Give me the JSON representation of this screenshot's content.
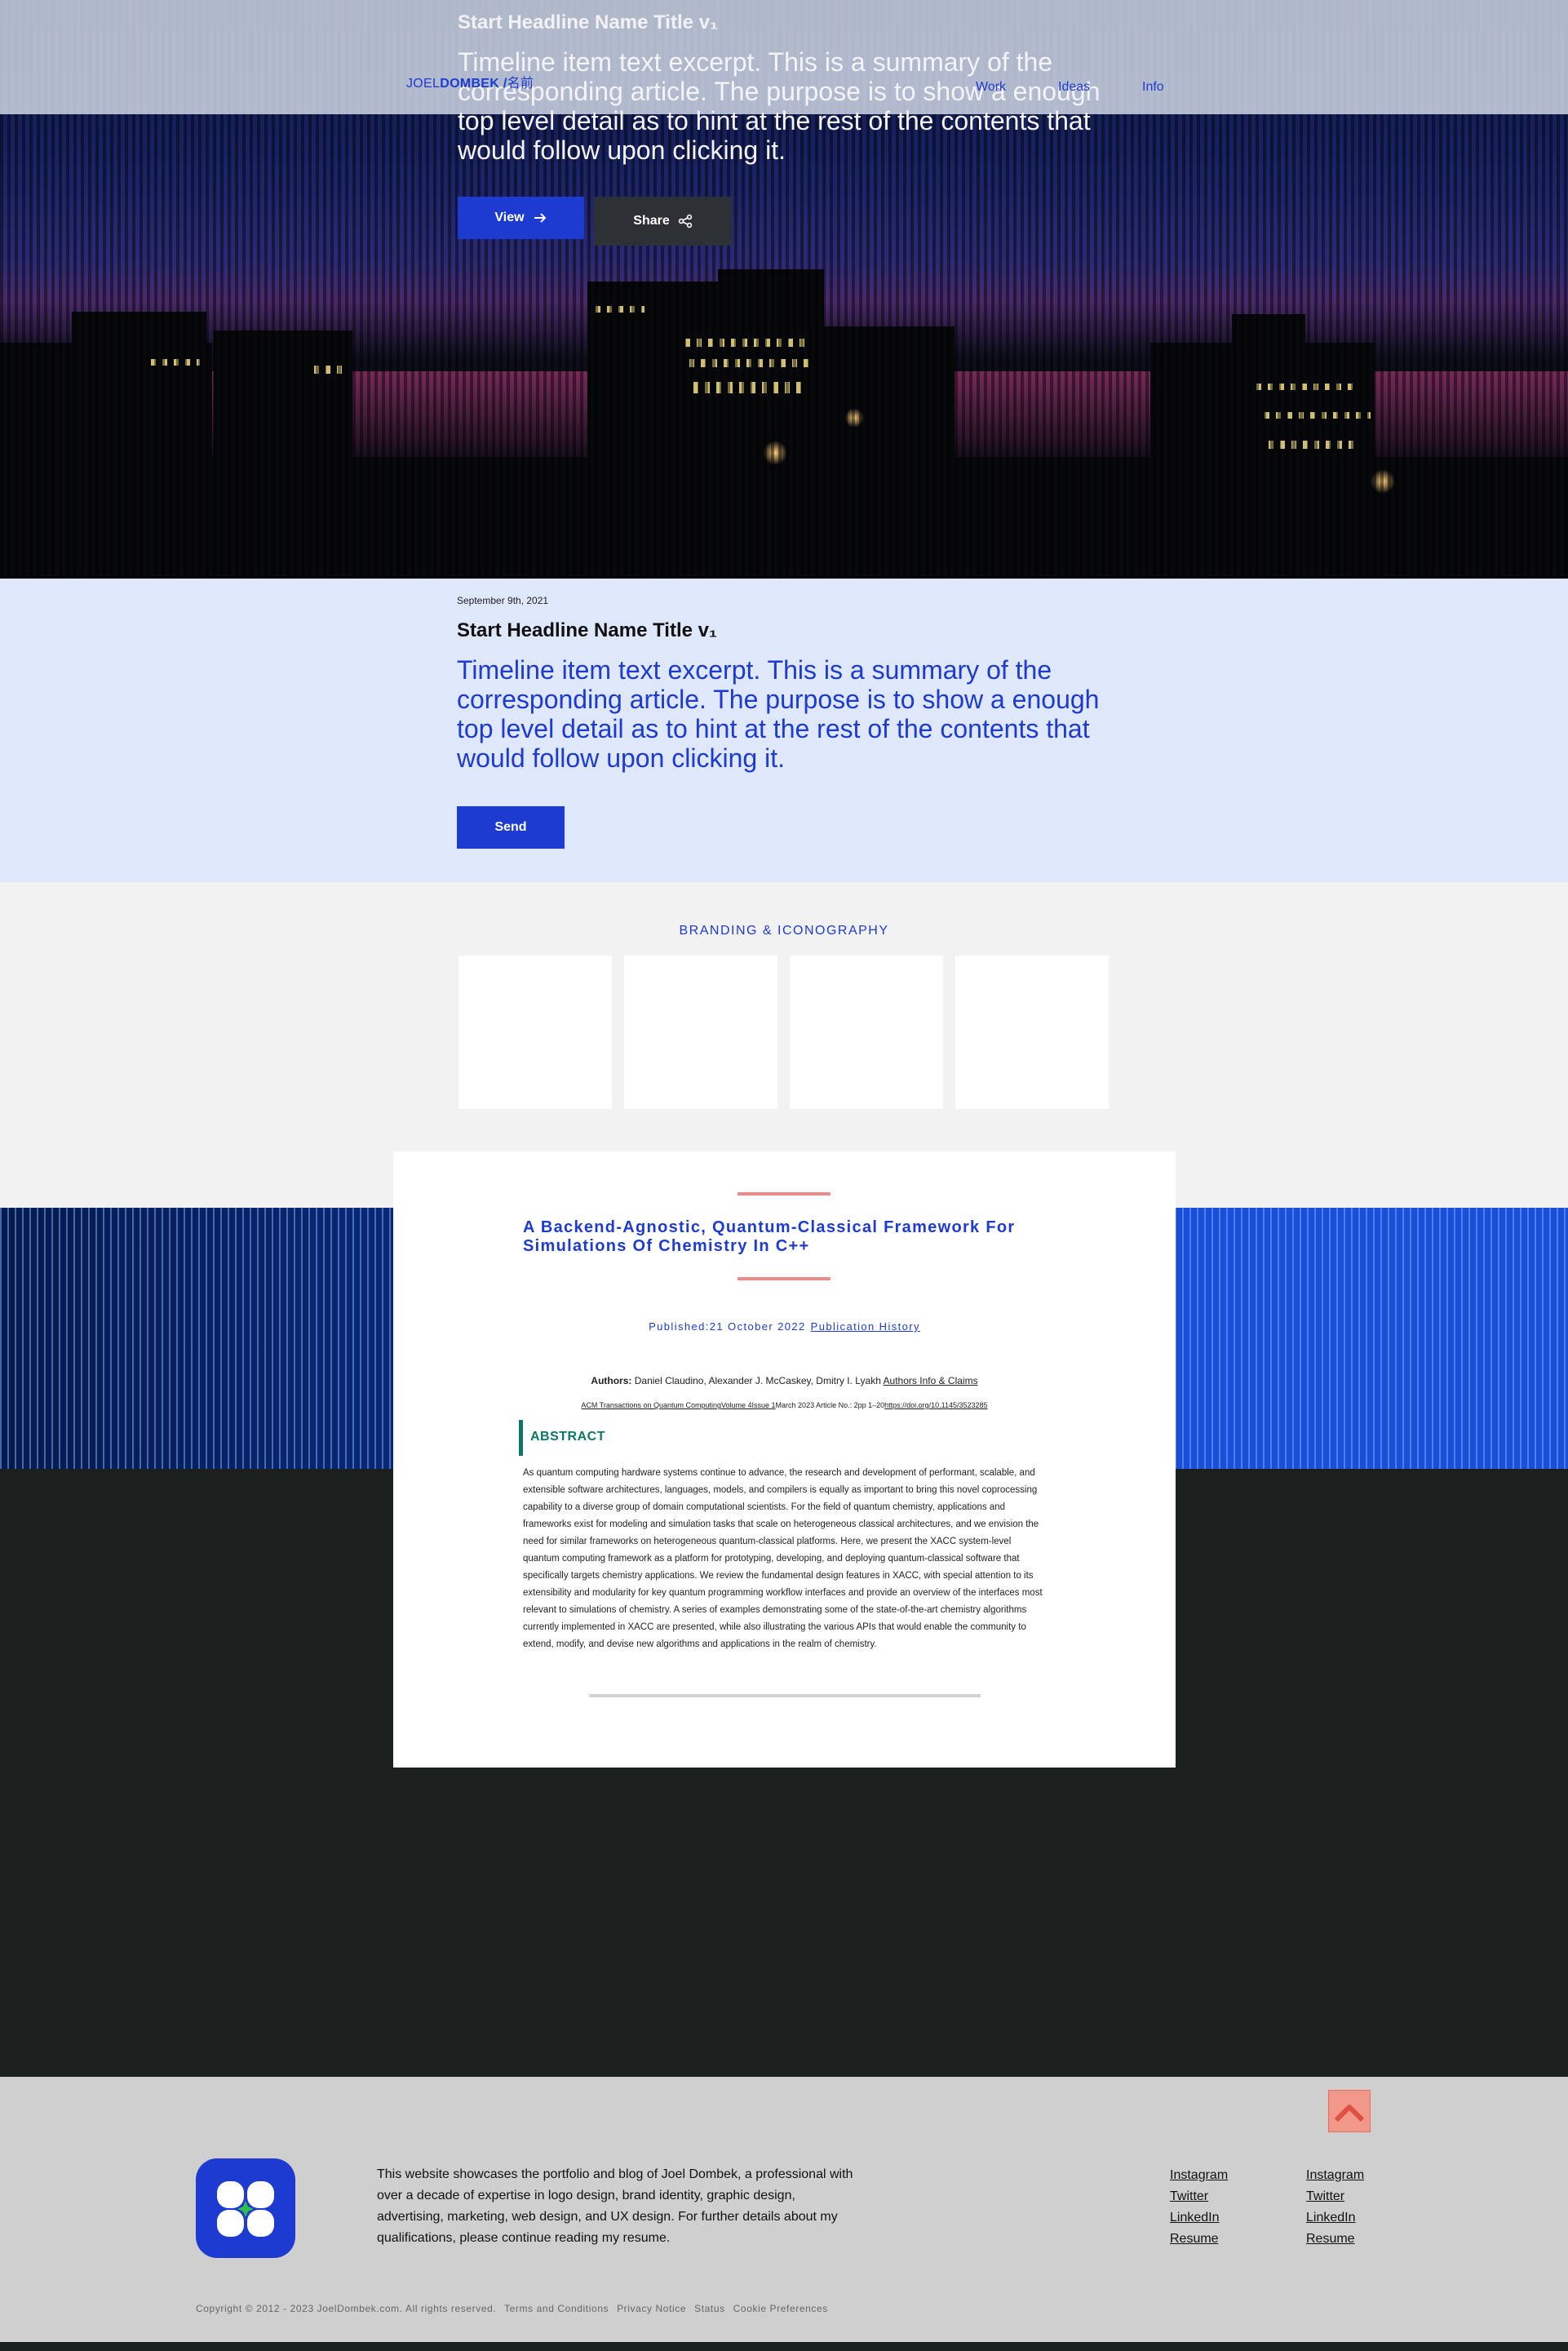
{
  "header": {
    "logo_first": "JOEL",
    "logo_last": "DOMBEK /",
    "logo_kanji": "名前",
    "nav": [
      "Work",
      "Ideas",
      "Info"
    ]
  },
  "hero": {
    "title": "Start Headline Name Title v₁",
    "excerpt": "Timeline item text excerpt. This is a summary of the corresponding article. The purpose is to show a enough top level detail as to hint at the rest of the contents that would follow upon clicking it.",
    "view_label": "View",
    "share_label": "Share"
  },
  "article": {
    "date": "September 9th, 2021",
    "title": "Start Headline Name Title v₁",
    "excerpt": "Timeline item text excerpt. This is a summary of the corresponding article. The purpose is to show a enough top level detail as to hint at the rest of the contents that would follow upon clicking it.",
    "send_label": "Send"
  },
  "branding": {
    "label": "BRANDING & ICONOGRAPHY",
    "tiles": 4
  },
  "paper": {
    "title": "A Backend-Agnostic, Quantum-Classical Framework For Simulations Of Chemistry In C++",
    "published": "Published:21 October 2022",
    "publication_history": "Publication History",
    "authors_label": "Authors:",
    "authors": "Daniel Claudino, Alexander J. McCaskey, Dmitry I. Lyakh",
    "authors_link": "Authors Info & Claims",
    "journal_link": "ACM Transactions on Quantum ComputingVolume 4Issue 1",
    "journal_meta": "March 2023 Article No.: 2pp 1–20",
    "doi": "https://doi.org/10.1145/3523285",
    "abstract_heading": "ABSTRACT",
    "abstract": "As quantum computing hardware systems continue to advance, the research and development of performant, scalable, and extensible software architectures, languages, models, and compilers is equally as important to bring this novel coprocessing capability to a diverse group of domain computational scientists. For the field of quantum chemistry, applications and frameworks exist for modeling and simulation tasks that scale on heterogeneous classical architectures, and we envision the need for similar frameworks on heterogeneous quantum-classical platforms. Here, we present the XACC system-level quantum computing framework as a platform for prototyping, developing, and deploying quantum-classical software that specifically targets chemistry applications. We review the fundamental design features in XACC, with special attention to its extensibility and modularity for key quantum programming workflow interfaces and provide an overview of the interfaces most relevant to simulations of chemistry. A series of examples demonstrating some of the state-of-the-art chemistry algorithms currently implemented in XACC are presented, while also illustrating the various APIs that would enable the community to extend, modify, and devise new algorithms and applications in the realm of chemistry."
  },
  "footer": {
    "blurb": "This website showcases the portfolio and blog of Joel Dombek, a professional with over a decade of expertise in logo design, brand identity, graphic design, advertising, marketing, web design, and UX design. For further details about my qualifications, please continue reading my resume.",
    "links_col1": [
      "Instagram",
      "Twitter",
      "LinkedIn",
      "Resume"
    ],
    "links_col2": [
      "Instagram",
      "Twitter",
      "LinkedIn",
      "Resume"
    ],
    "copyright": "Copyright © 2012 - 2023 JoelDombek.com. All rights reserved.",
    "legal": [
      "Terms and Conditions",
      "Privacy Notice",
      "Status",
      "Cookie Preferences"
    ]
  },
  "colors": {
    "accent": "#1d3bd1",
    "abstract": "#0c7667",
    "divider": "#ef8a8a",
    "scroll_top": "#f2988a",
    "footer_bg": "#cfcfcf",
    "section_bg": "#dfe7fb"
  }
}
